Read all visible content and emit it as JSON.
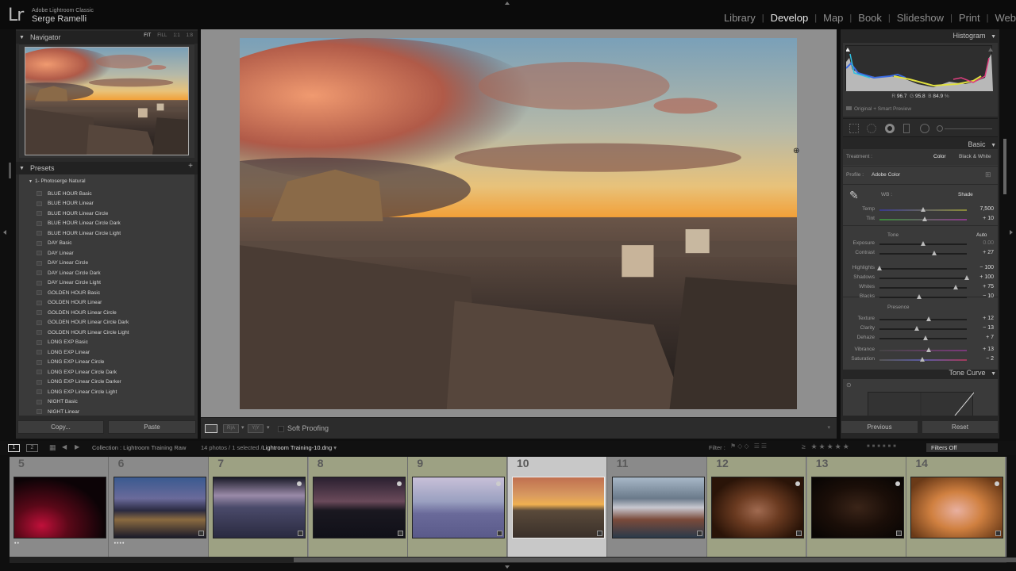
{
  "app": {
    "logo": "Lr",
    "product": "Adobe Lightroom Classic",
    "user": "Serge Ramelli"
  },
  "modules": [
    {
      "label": "Library",
      "active": false
    },
    {
      "label": "Develop",
      "active": true
    },
    {
      "label": "Map",
      "active": false
    },
    {
      "label": "Book",
      "active": false
    },
    {
      "label": "Slideshow",
      "active": false
    },
    {
      "label": "Print",
      "active": false
    },
    {
      "label": "Web",
      "active": false
    }
  ],
  "navigator": {
    "title": "Navigator",
    "zoom_options": [
      "FIT",
      "FILL",
      "1:1",
      "1:8"
    ],
    "active_zoom": "FIT"
  },
  "presets": {
    "title": "Presets",
    "add_label": "+",
    "folder": "1- Photoserge Natural",
    "items": [
      "BLUE HOUR Basic",
      "BLUE HOUR Linear",
      "BLUE HOUR Linear Circle",
      "BLUE HOUR Linear Circle Dark",
      "BLUE HOUR Linear Circle Light",
      "DAY Basic",
      "DAY Linear",
      "DAY Linear Circle",
      "DAY Linear Circle Dark",
      "DAY Linear Circle Light",
      "GOLDEN HOUR Basic",
      "GOLDEN HOUR Linear",
      "GOLDEN HOUR Linear Circle",
      "GOLDEN HOUR Linear Circle Dark",
      "GOLDEN HOUR Linear Circle Light",
      "LONG EXP Basic",
      "LONG EXP Linear",
      "LONG EXP Linear Circle",
      "LONG EXP Linear Circle Dark",
      "LONG EXP Linear Circle Darker",
      "LONG EXP Linear Circle Light",
      "NIGHT Basic",
      "NIGHT Linear"
    ]
  },
  "left_buttons": {
    "copy": "Copy...",
    "paste": "Paste"
  },
  "toolbar": {
    "view_ra": "R|A",
    "view_yy": "Y|Y",
    "soft_proofing": "Soft Proofing",
    "soft_proofing_checked": false
  },
  "histogram": {
    "title": "Histogram",
    "r_label": "R",
    "r": "96.7",
    "g_label": "G",
    "g": "95.8",
    "b_label": "B",
    "b": "84.9",
    "unit": "%",
    "preview": "Original + Smart Preview"
  },
  "basic": {
    "title": "Basic",
    "treatment_label": "Treatment :",
    "treatment_color": "Color",
    "treatment_bw": "Black & White",
    "profile_label": "Profile :",
    "profile_value": "Adobe Color",
    "wb_label": "WB :",
    "wb_value": "Shade",
    "tone_label": "Tone",
    "auto_label": "Auto",
    "presence_label": "Presence",
    "sliders": [
      {
        "name": "Temp",
        "value": "7,500",
        "pos": 0.5
      },
      {
        "name": "Tint",
        "value": "+ 10",
        "pos": 0.52
      },
      {
        "name": "Exposure",
        "value": "0.00",
        "pos": 0.5
      },
      {
        "name": "Contrast",
        "value": "+ 27",
        "pos": 0.63
      },
      {
        "name": "Highlights",
        "value": "− 100",
        "pos": 0.0
      },
      {
        "name": "Shadows",
        "value": "+ 100",
        "pos": 1.0
      },
      {
        "name": "Whites",
        "value": "+ 75",
        "pos": 0.87
      },
      {
        "name": "Blacks",
        "value": "− 10",
        "pos": 0.45
      },
      {
        "name": "Texture",
        "value": "+ 12",
        "pos": 0.56
      },
      {
        "name": "Clarity",
        "value": "− 13",
        "pos": 0.43
      },
      {
        "name": "Dehaze",
        "value": "+ 7",
        "pos": 0.53
      },
      {
        "name": "Vibrance",
        "value": "+ 13",
        "pos": 0.56
      },
      {
        "name": "Saturation",
        "value": "− 2",
        "pos": 0.49
      }
    ]
  },
  "tone_curve": {
    "title": "Tone Curve"
  },
  "right_buttons": {
    "previous": "Previous",
    "reset": "Reset"
  },
  "filmstrip_bar": {
    "view1": "1",
    "view2": "2",
    "source": "Collection : Lightroom Training Raw",
    "count": "14 photos / 1 selected /",
    "filename": "Lightroom Training-10.dng",
    "filter_label": "Filter :",
    "rating_op": "≥",
    "filters_value": "Filters Off"
  },
  "filmstrip": [
    {
      "num": "5",
      "style": "grey",
      "dots": "••",
      "theme": "red-night"
    },
    {
      "num": "6",
      "style": "grey",
      "dots": "••••",
      "theme": "dusk-city"
    },
    {
      "num": "7",
      "style": "green",
      "dots": "",
      "theme": "pier-dusk"
    },
    {
      "num": "8",
      "style": "green",
      "dots": "",
      "theme": "pier-dark"
    },
    {
      "num": "9",
      "style": "green",
      "dots": "",
      "theme": "pier-light"
    },
    {
      "num": "10",
      "style": "sel",
      "dots": "",
      "theme": "paris-sunset"
    },
    {
      "num": "11",
      "style": "grey",
      "dots": "",
      "theme": "harbor"
    },
    {
      "num": "12",
      "style": "green",
      "dots": "",
      "theme": "arch-warm"
    },
    {
      "num": "13",
      "style": "green",
      "dots": "",
      "theme": "arch-dark"
    },
    {
      "num": "14",
      "style": "green",
      "dots": "",
      "theme": "arch-bright"
    }
  ]
}
